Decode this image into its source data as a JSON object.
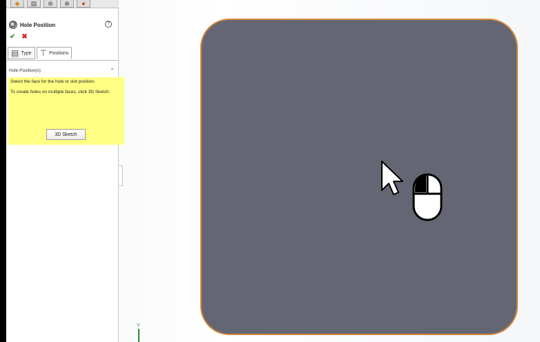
{
  "panel": {
    "tab_icons": [
      "feature-manager-icon",
      "property-manager-icon",
      "configuration-manager-icon",
      "dimxpert-icon",
      "display-manager-icon"
    ],
    "title": "Hole Position",
    "help_glyph": "?",
    "ok_glyph": "✔",
    "cancel_glyph": "✖",
    "tabs": [
      {
        "label": "Type",
        "glyph": "▤"
      },
      {
        "label": "Positions",
        "glyph": "⊤"
      }
    ],
    "section": {
      "title": "Hole Position(s)",
      "collapse_glyph": "⌃",
      "hint_line1": "Select the face for the hole or slot position.",
      "hint_line2": "To create holes on multiple faces, click 3D Sketch.",
      "button_label": "3D Sketch"
    }
  },
  "graphics": {
    "triad_label": "Y",
    "part_face_color": "#646673",
    "part_edge_color": "#d4893c"
  }
}
